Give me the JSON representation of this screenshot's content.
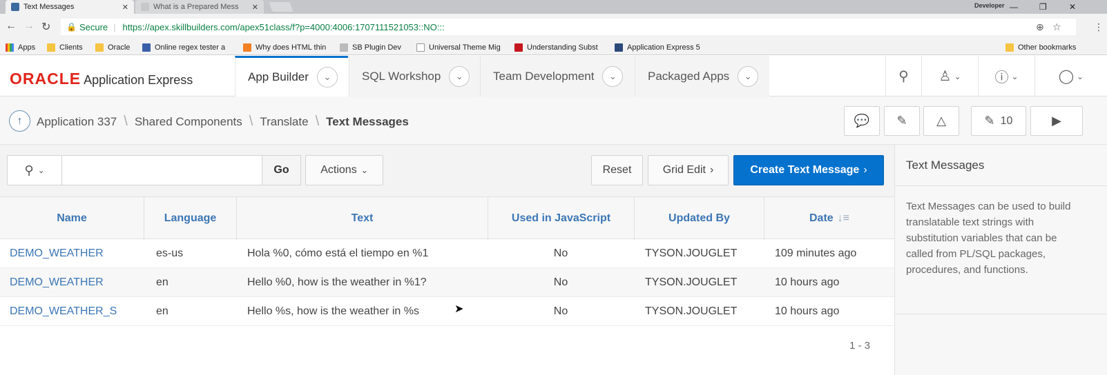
{
  "browser": {
    "tabs": [
      {
        "title": "Text Messages",
        "active": true
      },
      {
        "title": "What is a Prepared Mess",
        "active": false
      }
    ],
    "profile": "Developer",
    "secure_label": "Secure",
    "url_host": "https://apex.skillbuilders.com",
    "url_path": "/apex51class/f?p=4000:4006:1707111521053::NO:::",
    "bookmarks": [
      "Apps",
      "Clients",
      "Oracle",
      "Online regex tester a",
      "Why does HTML thin",
      "SB Plugin Dev",
      "Universal Theme Mig",
      "Understanding Subst",
      "Application Express 5"
    ],
    "other_bookmarks": "Other bookmarks"
  },
  "header": {
    "logo_oracle": "ORACLE",
    "logo_product": "Application Express",
    "nav_tabs": [
      "App Builder",
      "SQL Workshop",
      "Team Development",
      "Packaged Apps"
    ]
  },
  "breadcrumb": {
    "items": [
      "Application 337",
      "Shared Components",
      "Translate"
    ],
    "current": "Text Messages",
    "edit_count": "10"
  },
  "toolbar": {
    "search_placeholder": "",
    "go_label": "Go",
    "actions_label": "Actions",
    "reset_label": "Reset",
    "grid_edit_label": "Grid Edit",
    "create_label": "Create Text Message"
  },
  "table": {
    "columns": [
      "Name",
      "Language",
      "Text",
      "Used in JavaScript",
      "Updated By",
      "Date"
    ],
    "rows": [
      {
        "name": "DEMO_WEATHER",
        "language": "es-us",
        "text": "Hola %0, cómo está el tiempo en %1",
        "used_js": "No",
        "updated_by": "TYSON.JOUGLET",
        "date": "109 minutes ago"
      },
      {
        "name": "DEMO_WEATHER",
        "language": "en",
        "text": "Hello %0, how is the weather in %1?",
        "used_js": "No",
        "updated_by": "TYSON.JOUGLET",
        "date": "10 hours ago"
      },
      {
        "name": "DEMO_WEATHER_S",
        "language": "en",
        "text": "Hello %s, how is the weather in %s",
        "used_js": "No",
        "updated_by": "TYSON.JOUGLET",
        "date": "10 hours ago"
      }
    ],
    "pagination": "1 - 3"
  },
  "side_panel": {
    "title": "Text Messages",
    "description": "Text Messages can be used to build translatable text strings with substitution variables that can be called from PL/SQL packages, procedures, and functions."
  },
  "colors": {
    "oracle_red": "#e2231a",
    "apex_blue": "#0572ce",
    "link_blue": "#3c76b5"
  }
}
